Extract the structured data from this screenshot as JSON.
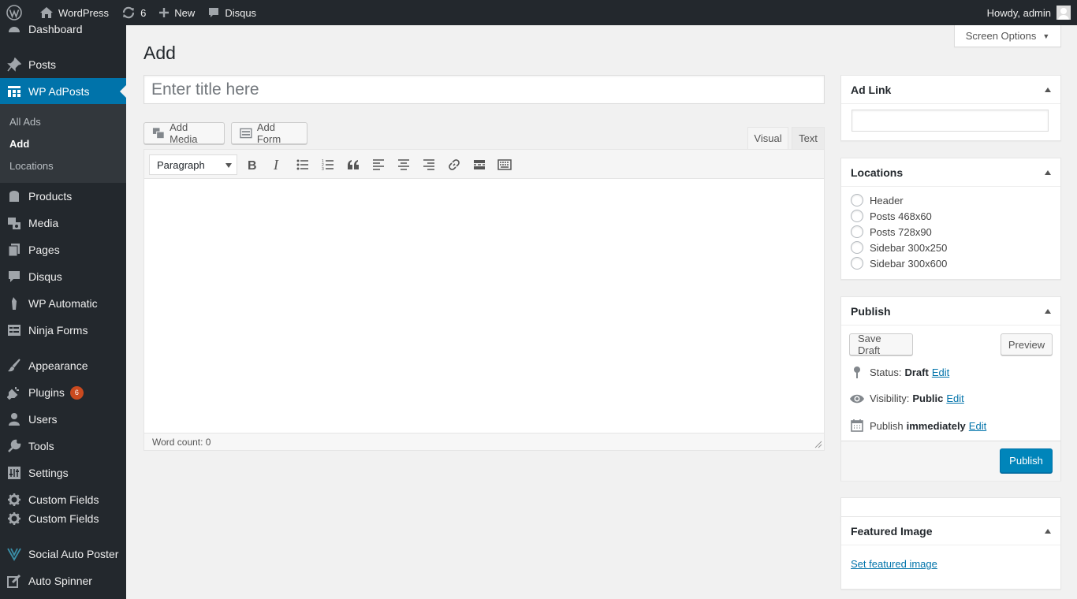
{
  "adminbar": {
    "site_name": "WordPress",
    "updates_count": "6",
    "new_label": "New",
    "disqus_label": "Disqus",
    "greeting": "Howdy, admin"
  },
  "sidebar": {
    "items": [
      {
        "label": "Dashboard",
        "icon": "dashboard-icon"
      },
      {
        "label": "Posts",
        "icon": "pin-icon"
      },
      {
        "label": "WP AdPosts",
        "icon": "grid-icon"
      },
      {
        "label": "Products",
        "icon": "archive-icon"
      },
      {
        "label": "Media",
        "icon": "media-icon"
      },
      {
        "label": "Pages",
        "icon": "page-icon"
      },
      {
        "label": "Disqus",
        "icon": "comment-icon"
      },
      {
        "label": "WP Automatic",
        "icon": "robot-icon"
      },
      {
        "label": "Ninja Forms",
        "icon": "form-icon"
      },
      {
        "label": "Appearance",
        "icon": "brush-icon"
      },
      {
        "label": "Plugins",
        "icon": "plugin-icon",
        "badge": "6"
      },
      {
        "label": "Users",
        "icon": "user-icon"
      },
      {
        "label": "Tools",
        "icon": "wrench-icon"
      },
      {
        "label": "Settings",
        "icon": "settings-icon"
      },
      {
        "label": "Custom Fields",
        "icon": "gear-icon"
      },
      {
        "label": "Custom Fields",
        "icon": "gear-icon"
      },
      {
        "label": "Social Auto Poster",
        "icon": "antenna-icon"
      },
      {
        "label": "Auto Spinner",
        "icon": "edit-icon"
      }
    ],
    "submenu": [
      "All Ads",
      "Add",
      "Locations"
    ]
  },
  "screen_options": "Screen Options",
  "page_title": "Add",
  "title_placeholder": "Enter title here",
  "editor": {
    "add_media": "Add Media",
    "add_form": "Add Form",
    "tab_visual": "Visual",
    "tab_text": "Text",
    "format": "Paragraph",
    "word_count": "Word count: 0"
  },
  "ad_link": {
    "title": "Ad Link",
    "value": ""
  },
  "locations": {
    "title": "Locations",
    "options": [
      "Header",
      "Posts 468x60",
      "Posts 728x90",
      "Sidebar 300x250",
      "Sidebar 300x600"
    ]
  },
  "publish": {
    "title": "Publish",
    "save_draft": "Save Draft",
    "preview": "Preview",
    "status_label": "Status:",
    "status_value": "Draft",
    "visibility_label": "Visibility:",
    "visibility_value": "Public",
    "publish_label": "Publish",
    "publish_value": "immediately",
    "edit": "Edit",
    "publish_button": "Publish"
  },
  "featured": {
    "title": "Featured Image",
    "link": "Set featured image"
  }
}
